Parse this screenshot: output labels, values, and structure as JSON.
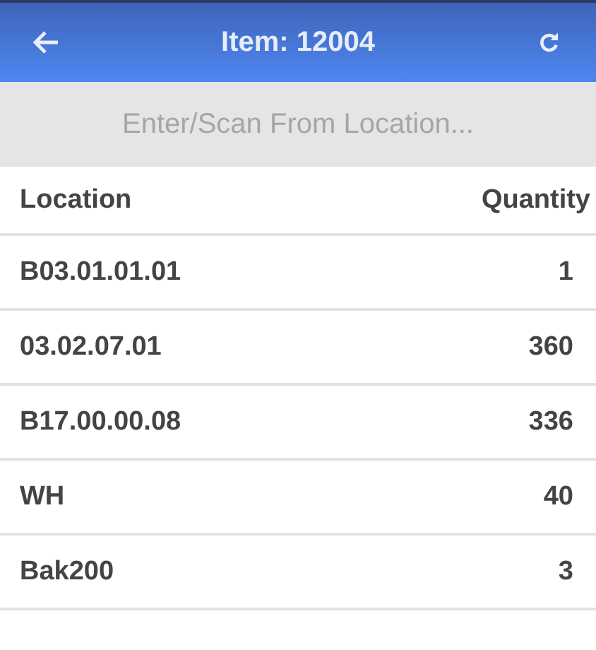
{
  "header": {
    "title": "Item: 12004"
  },
  "search": {
    "placeholder": "Enter/Scan From Location..."
  },
  "table": {
    "columns": [
      "Location",
      "Quantity"
    ],
    "rows": [
      {
        "location": "B03.01.01.01",
        "quantity": "1"
      },
      {
        "location": "03.02.07.01",
        "quantity": "360"
      },
      {
        "location": "B17.00.00.08",
        "quantity": "336"
      },
      {
        "location": "WH",
        "quantity": "40"
      },
      {
        "location": "Bak200",
        "quantity": "3"
      }
    ]
  }
}
